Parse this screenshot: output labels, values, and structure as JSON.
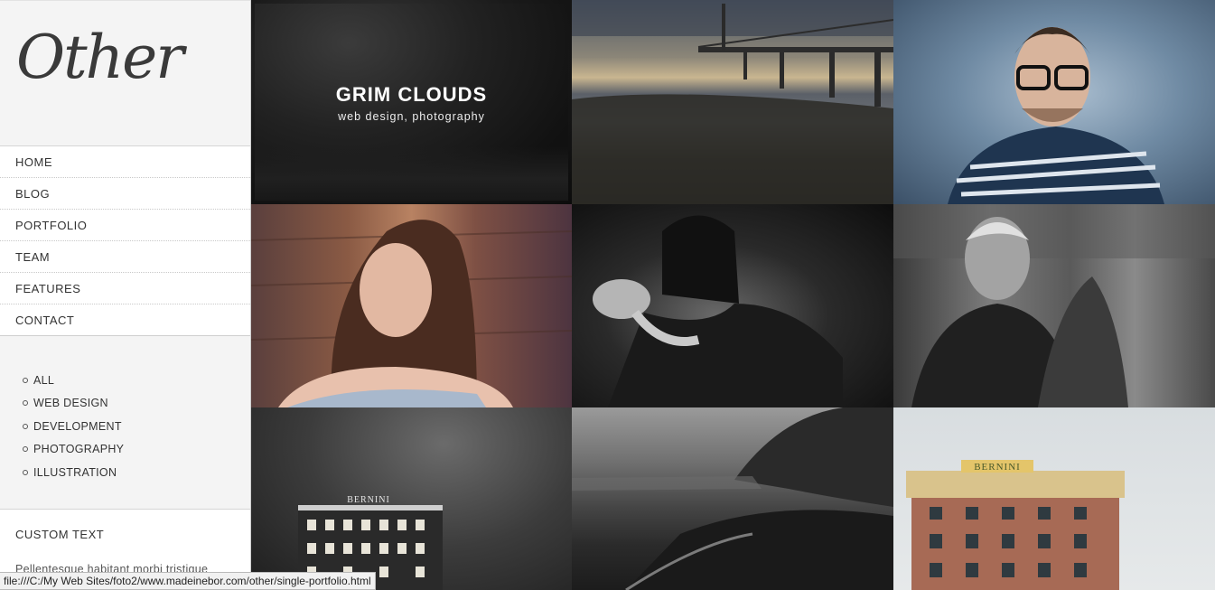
{
  "sidebar": {
    "logo_text": "Other",
    "nav": [
      {
        "label": "HOME"
      },
      {
        "label": "BLOG"
      },
      {
        "label": "PORTFOLIO"
      },
      {
        "label": "TEAM"
      },
      {
        "label": "FEATURES"
      },
      {
        "label": "CONTACT"
      }
    ],
    "filters": [
      {
        "label": "ALL"
      },
      {
        "label": "WEB DESIGN"
      },
      {
        "label": "DEVELOPMENT"
      },
      {
        "label": "PHOTOGRAPHY"
      },
      {
        "label": "ILLUSTRATION"
      }
    ],
    "custom_title": "CUSTOM TEXT",
    "custom_body": "Pellentesque habitant morbi tristique"
  },
  "grid": {
    "hover_title": "GRIM CLOUDS",
    "hover_subtitle": "web design, photography",
    "sign_text": "BERNINI"
  },
  "status_bar": {
    "url": "file:///C:/My Web Sites/foto2/www.madeinebor.com/other/single-portfolio.html"
  }
}
